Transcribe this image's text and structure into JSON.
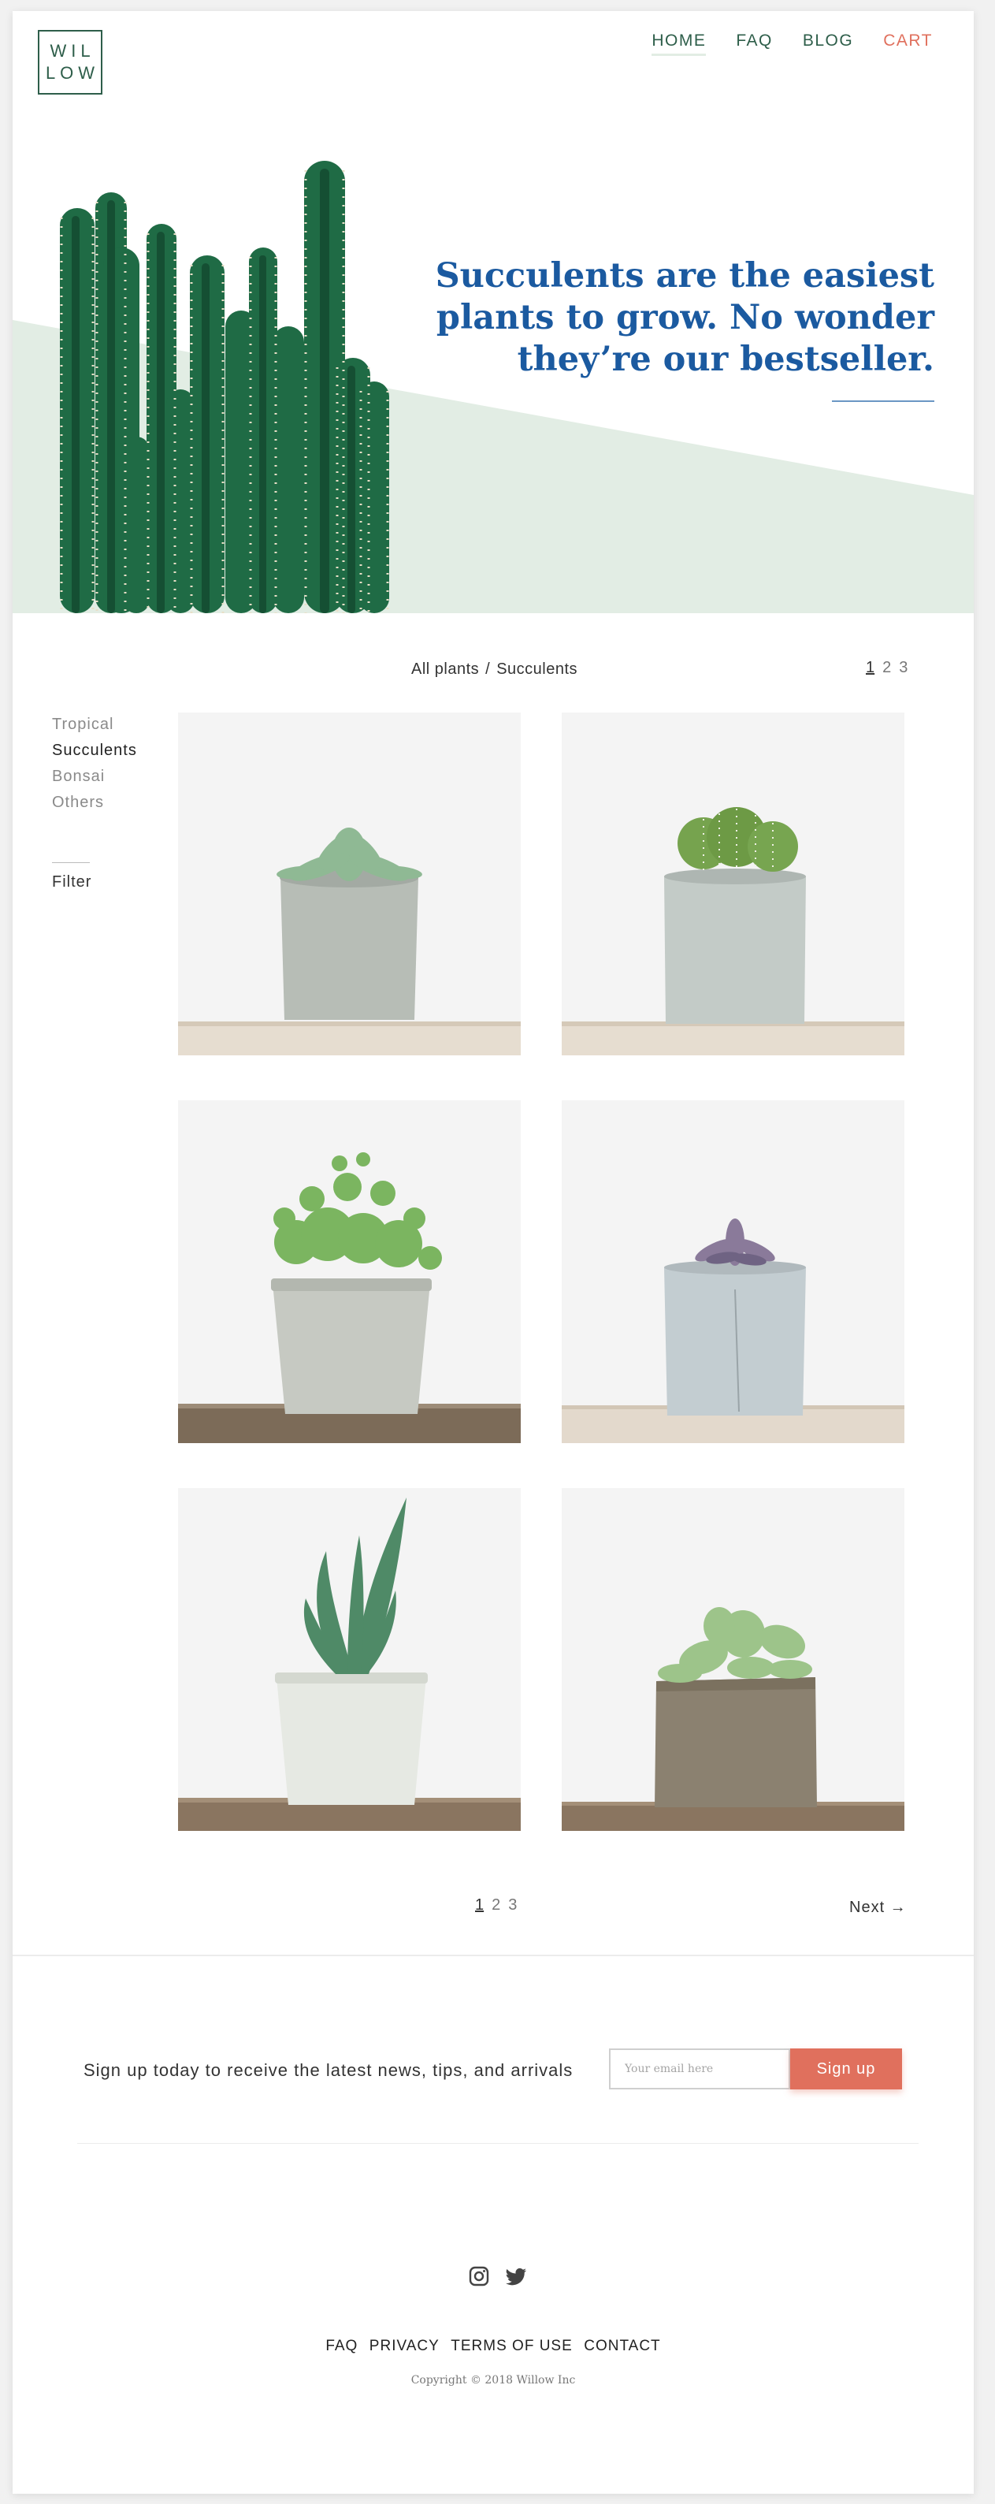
{
  "header": {
    "logo": [
      "WIL",
      "LOW"
    ],
    "nav": [
      "HOME",
      "FAQ",
      "BLOG",
      "CART"
    ],
    "accent_color": "#2e5e4a",
    "cart_color": "#e0705d"
  },
  "hero": {
    "title": "Succulents are the easiest plants to grow. No wonder they’re our bestseller.",
    "title_color": "#1b5aa0",
    "band_color": "#e2ede4",
    "image": "cactus-photo"
  },
  "listing": {
    "breadcrumb": [
      "All plants",
      "/",
      "Succulents"
    ],
    "pages": [
      "1",
      "2",
      "3"
    ],
    "current_page": "1",
    "categories": [
      "Tropical",
      "Succulents",
      "Bonsai",
      "Others"
    ],
    "active_category": "Succulents",
    "filter_label": "Filter",
    "products": [
      {
        "image": "rosette-succulent-concrete-pot"
      },
      {
        "image": "round-cactus-concrete-pot"
      },
      {
        "image": "string-succulent-concrete-pot"
      },
      {
        "image": "small-rosette-concrete-pot"
      },
      {
        "image": "aloe-white-pot"
      },
      {
        "image": "jade-square-concrete-pot"
      }
    ],
    "next_label": "Next →"
  },
  "newsletter": {
    "text": "Sign up today to receive the latest news, tips, and arrivals",
    "placeholder": "Your email here",
    "button": "Sign up",
    "button_color": "#e0705d"
  },
  "footer": {
    "social": [
      "instagram-icon",
      "twitter-icon"
    ],
    "links": [
      "FAQ",
      "PRIVACY",
      "TERMS OF USE",
      "CONTACT"
    ],
    "copyright": "Copyright © 2018 Willow Inc"
  }
}
